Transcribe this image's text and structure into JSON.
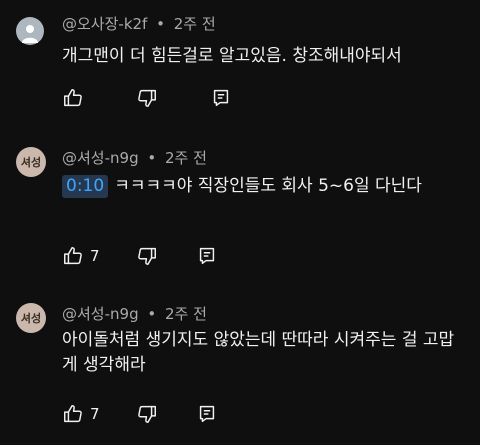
{
  "comments": [
    {
      "author": "@오사장-k2f",
      "age": "2주 전",
      "text": "개그맨이 더 힘든걸로 알고있음. 창조해내야되서",
      "timestamp": "",
      "likes": "",
      "avatar": "person-silhouette-icon"
    },
    {
      "author": "@셔성-n9g",
      "age": "2주 전",
      "timestamp": "0:10",
      "text": "ㅋㅋㅋㅋ야 직장인들도 회사 5~6일 다닌다",
      "likes": "7",
      "avatar_text": "셔성"
    },
    {
      "author": "@셔성-n9g",
      "age": "2주 전",
      "text": "아이돌처럼 생기지도 않았는데 딴따라 시켜주는 걸 고맙게 생각해라",
      "likes": "7",
      "avatar_text": "셔성"
    }
  ],
  "meta_separator": "•"
}
